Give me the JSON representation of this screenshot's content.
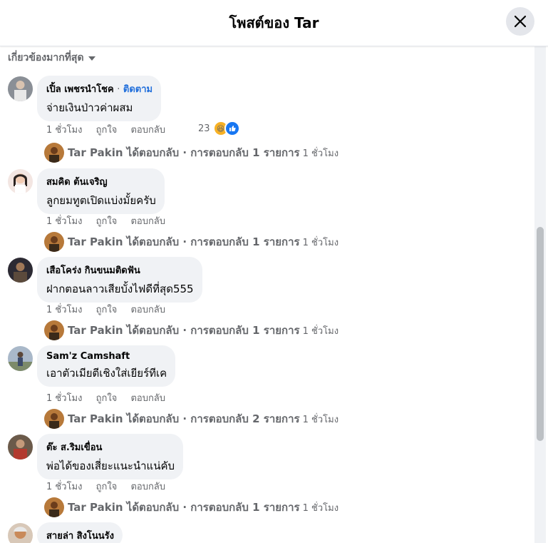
{
  "header": {
    "title": "โพสต์ของ Tar",
    "close_icon": "close-icon"
  },
  "sort": {
    "label": "เกี่ยวข้องมากที่สุด",
    "icon": "caret-down-icon"
  },
  "comments": [
    {
      "name": "เปิ้ล เพชรนำโชค",
      "separator": "·",
      "follow": "ติดตาม",
      "text": "จ่ายเงินป่าวค่าผสม",
      "time": "1 ชั่วโมง",
      "like": "ถูกใจ",
      "reply": "ตอบกลับ",
      "reaction_count": "23",
      "reaction_icons": [
        "haha-icon",
        "like-icon"
      ],
      "reply_summary": "Tar Pakin ได้ตอบกลับ · การตอบกลับ 1 รายการ",
      "reply_time": "1 ชั่วโมง"
    },
    {
      "name": "สมคิด ต้นเจริญ",
      "text": "ลูกยมทูตเปิดแบ่งมั้ยครับ",
      "time": "1 ชั่วโมง",
      "like": "ถูกใจ",
      "reply": "ตอบกลับ",
      "reply_summary": "Tar Pakin ได้ตอบกลับ · การตอบกลับ 1 รายการ",
      "reply_time": "1 ชั่วโมง"
    },
    {
      "name": "เสือโคร่ง กินขนมติดฟัน",
      "text": "ฝากตอนลาวเสียบั้งไฟดีที่สุด555",
      "time": "1 ชั่วโมง",
      "like": "ถูกใจ",
      "reply": "ตอบกลับ",
      "reply_summary": "Tar Pakin ได้ตอบกลับ · การตอบกลับ 1 รายการ",
      "reply_time": "1 ชั่วโมง"
    },
    {
      "name": "Sam'z Camshaft",
      "text": "เอาตัวเมียตีเชิงใส่เยียร์ทีเค",
      "time": "1 ชั่วโมง",
      "like": "ถูกใจ",
      "reply": "ตอบกลับ",
      "reply_summary": "Tar Pakin ได้ตอบกลับ · การตอบกลับ 2 รายการ",
      "reply_time": "1 ชั่วโมง"
    },
    {
      "name": "ต๊ะ ส.ริมเขื่อน",
      "text": "พ่อได้ของเสี่ยะแนะนำแน่คับ",
      "time": "1 ชั่วโมง",
      "like": "ถูกใจ",
      "reply": "ตอบกลับ",
      "reply_summary": "Tar Pakin ได้ตอบกลับ · การตอบกลับ 1 รายการ",
      "reply_time": "1 ชั่วโมง"
    },
    {
      "name": "สายล่า สิงโนนรัง"
    }
  ]
}
